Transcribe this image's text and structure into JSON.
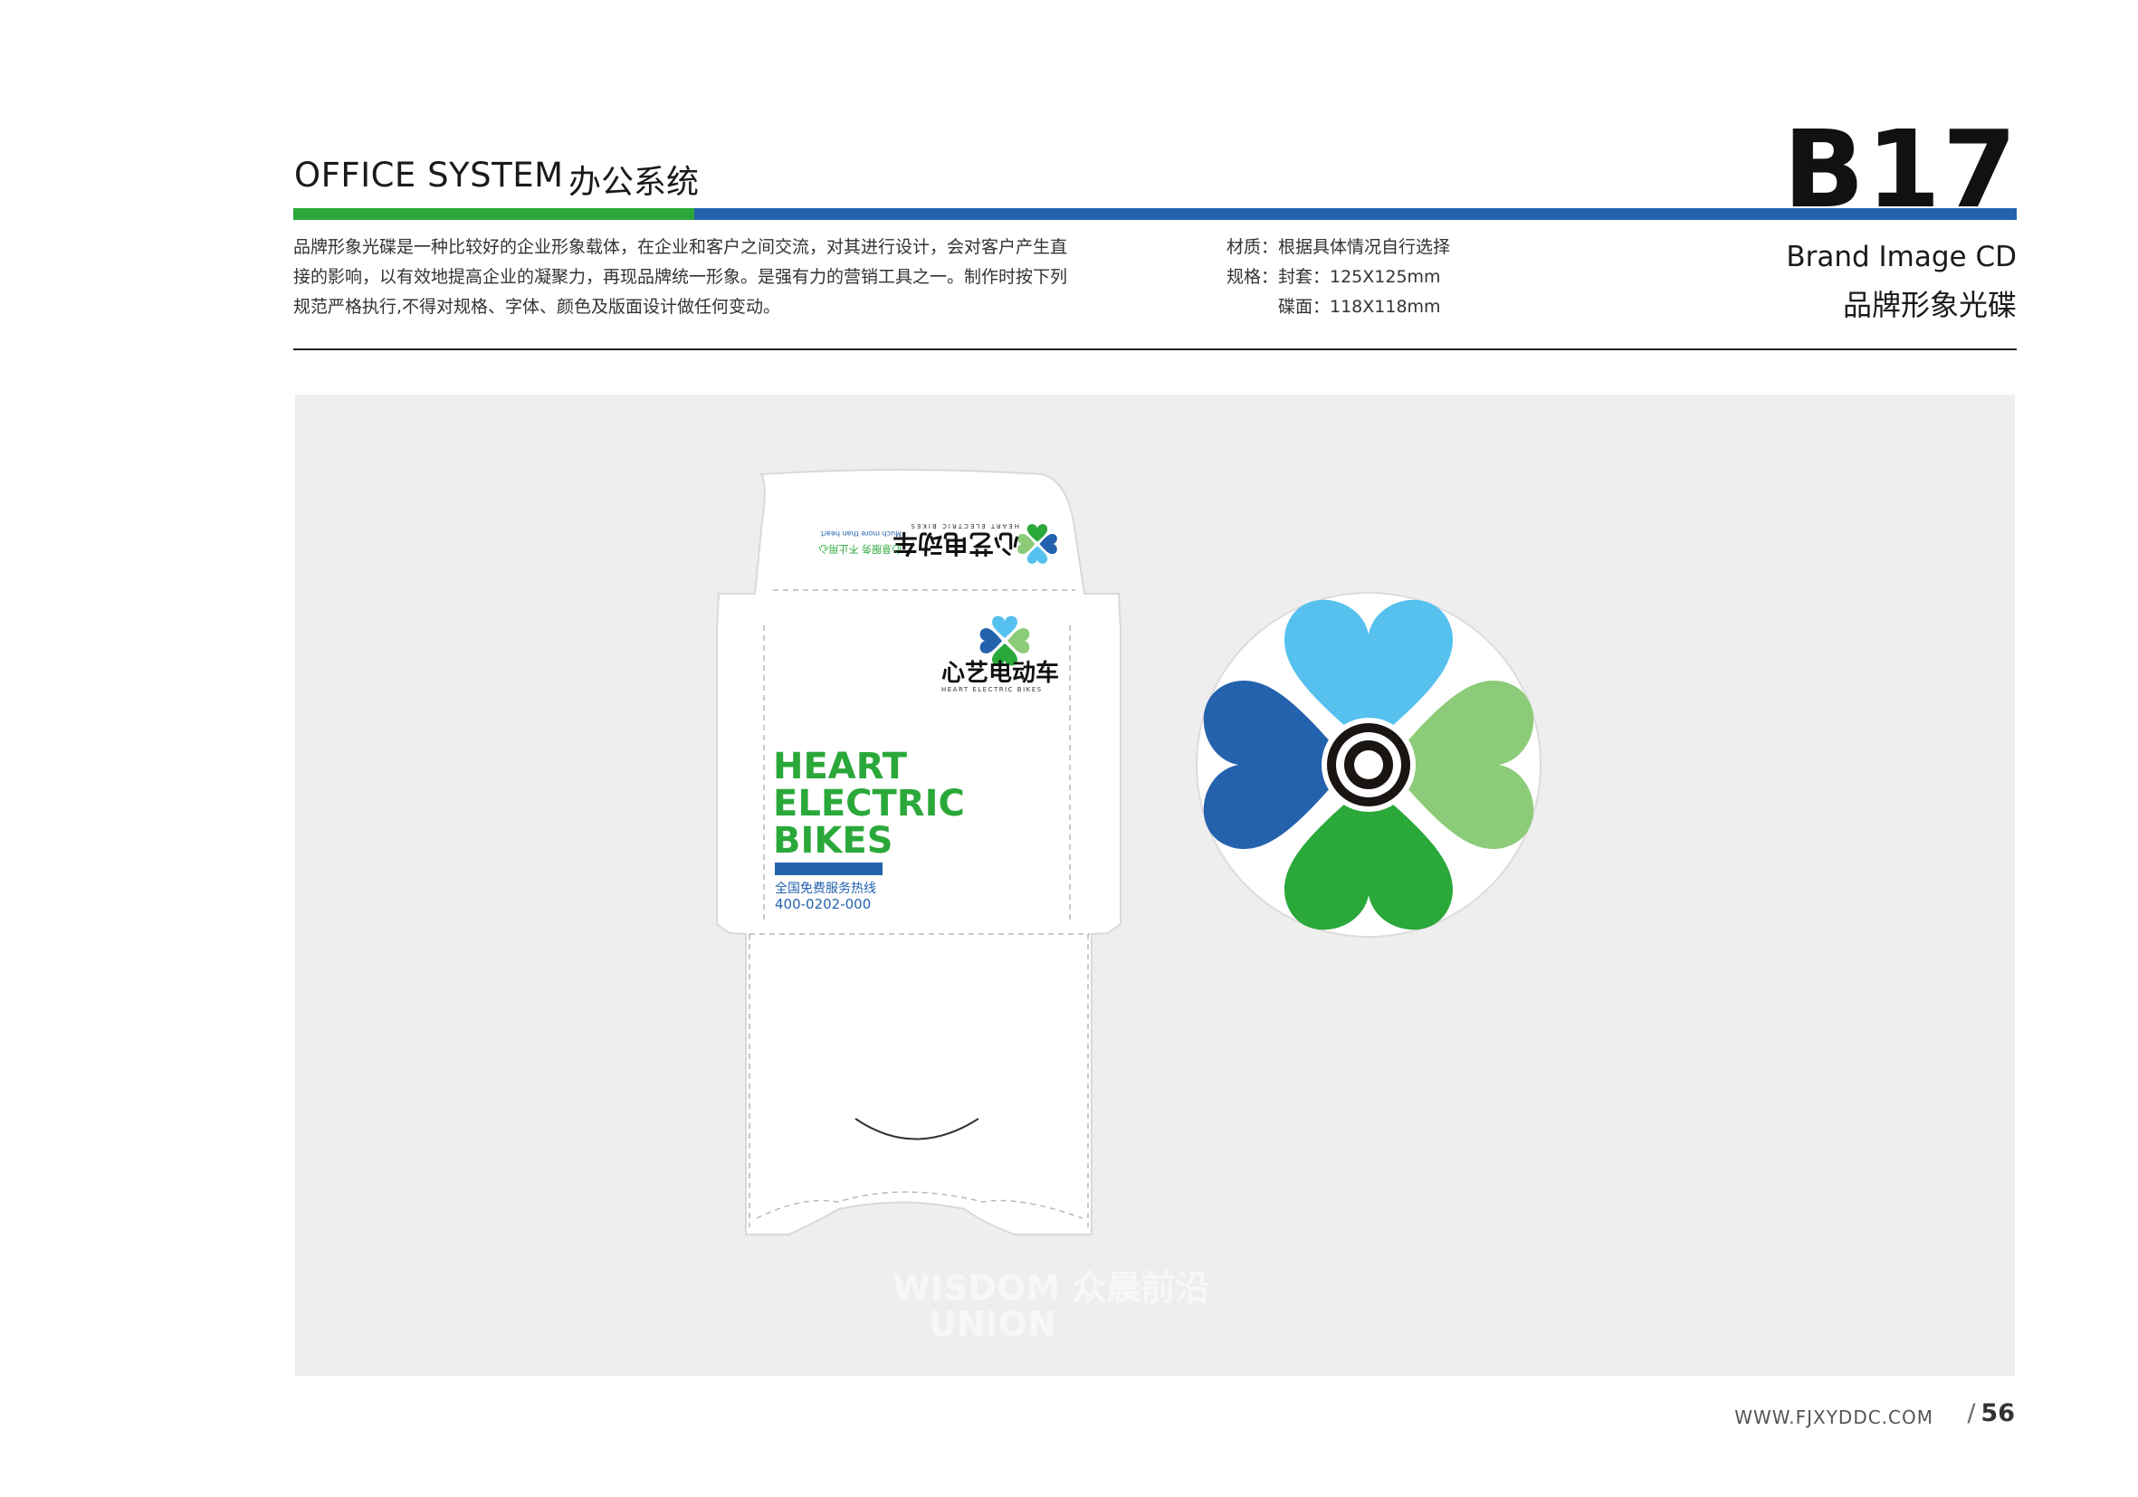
{
  "header": {
    "title_en": "OFFICE SYSTEM",
    "title_cn": "办公系统",
    "code": "B17",
    "accent_green": "#2aa83a",
    "accent_blue": "#2462ae"
  },
  "description": {
    "lines": [
      "品牌形象光碟是一种比较好的企业形象载体，在企业和客户之间交流，对其进行设计，会对客户产生直",
      "接的影响，以有效地提高企业的凝聚力，再现品牌统一形象。是强有力的营销工具之一。制作时按下列",
      "规范严格执行,不得对规格、字体、颜色及版面设计做任何变动。"
    ]
  },
  "specs": {
    "material": "材质：根据具体情况自行选择",
    "size_sleeve": "规格：封套：125X125mm",
    "size_disc": "碟面：118X118mm"
  },
  "section": {
    "name_en": "Brand Image CD",
    "name_cn": "品牌形象光碟"
  },
  "sleeve": {
    "flap_logo_cn": "心艺电动车",
    "flap_logo_en": "HEART ELECTRIC BIKES",
    "flap_slogan_cn": "心意服务 不止用心",
    "flap_slogan_en": "Much more than heart",
    "logo_cn": "心艺电动车",
    "logo_en": "HEART ELECTRIC BIKES",
    "headline_1": "HEART",
    "headline_2": "ELECTRIC",
    "headline_3": "BIKES",
    "hotline_label": "全国免费服务热线",
    "hotline_number": "400-0202-000"
  },
  "watermark": {
    "line1": "WISDOM 众晨前沿",
    "line2": "UNION"
  },
  "footer": {
    "website": "WWW.FJXYDDC.COM",
    "page_slash": "/",
    "page_number": "56"
  },
  "colors": {
    "logo_light_blue": "#56c1ee",
    "logo_dark_blue": "#2462ae",
    "logo_light_green": "#8ccb78",
    "logo_green": "#2aa83a"
  }
}
